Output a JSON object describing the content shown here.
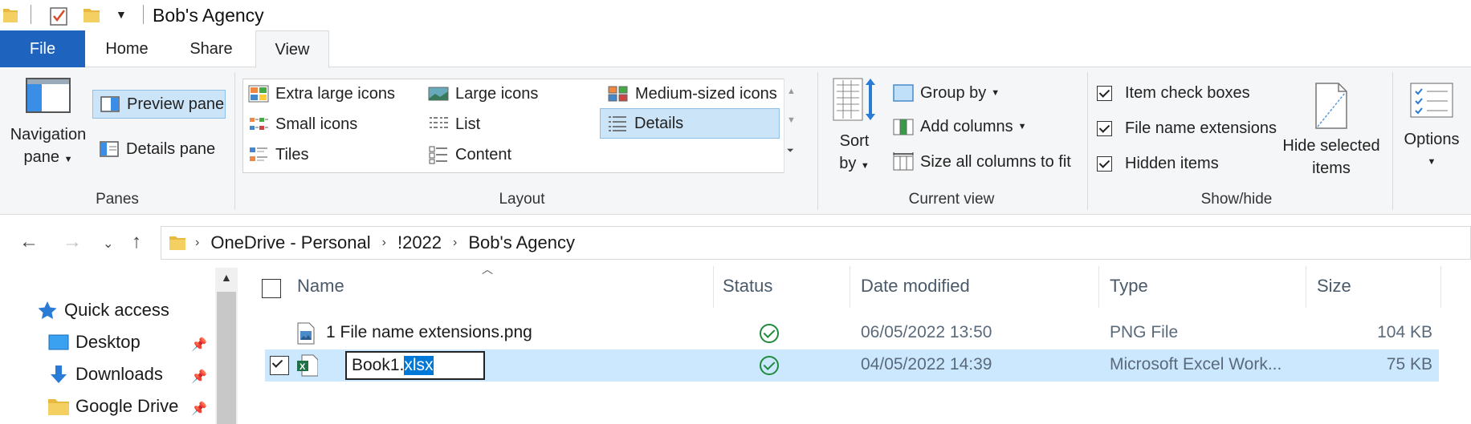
{
  "window": {
    "title": "Bob's Agency"
  },
  "tabs": [
    {
      "label": "File"
    },
    {
      "label": "Home"
    },
    {
      "label": "Share"
    },
    {
      "label": "View"
    }
  ],
  "ribbon": {
    "panes": {
      "group_label": "Panes",
      "navigation_pane": {
        "line1": "Navigation",
        "line2": "pane"
      },
      "preview_pane": "Preview pane",
      "details_pane": "Details pane"
    },
    "layout": {
      "group_label": "Layout",
      "items": [
        "Extra large icons",
        "Large icons",
        "Medium-sized icons",
        "Small icons",
        "List",
        "Details",
        "Tiles",
        "Content"
      ],
      "selected": "Details"
    },
    "current_view": {
      "group_label": "Current view",
      "sort_by": {
        "line1": "Sort",
        "line2": "by"
      },
      "group_by": "Group by",
      "add_columns": "Add columns",
      "size_all_columns": "Size all columns to fit"
    },
    "show_hide": {
      "group_label": "Show/hide",
      "item_check_boxes": "Item check boxes",
      "file_name_extensions": "File name extensions",
      "hidden_items": "Hidden items",
      "hide_selected_items": {
        "line1": "Hide selected",
        "line2": "items"
      }
    },
    "options": {
      "label": "Options"
    }
  },
  "address": {
    "segments": [
      "OneDrive - Personal",
      "!2022",
      "Bob's Agency"
    ]
  },
  "nav_pane": {
    "quick_access": "Quick access",
    "items": [
      {
        "label": "Desktop"
      },
      {
        "label": "Downloads"
      },
      {
        "label": "Google Drive"
      }
    ]
  },
  "file_list": {
    "columns": {
      "name": "Name",
      "status": "Status",
      "date": "Date modified",
      "type": "Type",
      "size": "Size"
    },
    "rows": [
      {
        "name": "1 File name extensions.png",
        "date": "06/05/2022 13:50",
        "type": "PNG File",
        "size": "104 KB"
      },
      {
        "name_base": "Book1.",
        "name_ext": "xlsx",
        "date": "04/05/2022 14:39",
        "type": "Microsoft Excel Work...",
        "size": "75 KB"
      }
    ]
  },
  "colors": {
    "file_tab": "#1e64be",
    "selection": "#cce8ff",
    "accent": "#0078d7",
    "status_ok": "#1f8a3b"
  }
}
